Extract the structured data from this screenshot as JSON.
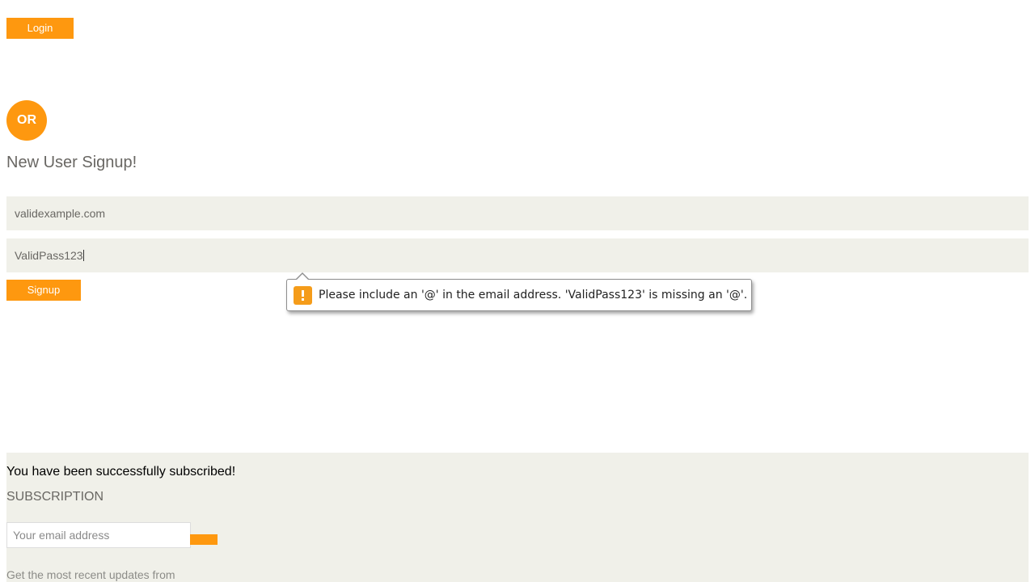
{
  "login": {
    "button_label": "Login"
  },
  "divider": {
    "or_label": "OR"
  },
  "signup": {
    "title": "New User Signup!",
    "email_value": "validexample.com",
    "password_value": "ValidPass123",
    "button_label": "Signup"
  },
  "validation": {
    "message": "Please include an '@' in the email address. 'ValidPass123' is missing an '@'.",
    "icon": "warning-icon"
  },
  "footer": {
    "success_message": "You have been successfully subscribed!",
    "subscription_heading": "SUBSCRIPTION",
    "email_placeholder": "Your email address",
    "description": "Get the most recent updates from"
  },
  "colors": {
    "accent": "#fe980f",
    "field_bg": "#f0f0e9",
    "muted_text": "#696763"
  }
}
